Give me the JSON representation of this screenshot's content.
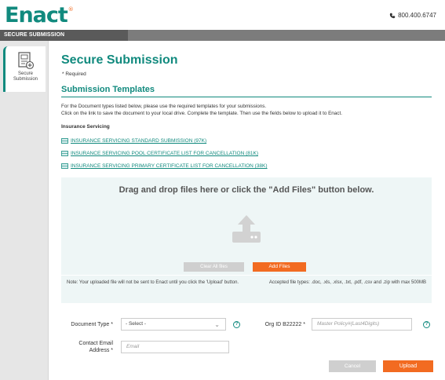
{
  "header": {
    "logo_text": "Enact",
    "logo_mark": "®",
    "phone": "800.400.6747",
    "phone_icon": "phone-icon"
  },
  "topbar": {
    "label": "SECURE SUBMISSION"
  },
  "sidebar": {
    "items": [
      {
        "label_line1": "Secure",
        "label_line2": "Submission",
        "icon": "document-add-icon"
      }
    ]
  },
  "main": {
    "title": "Secure Submission",
    "required_note": "* Required",
    "subtitle": "Submission Templates",
    "instructions_line1": "For the Document types listed below, please use the required templates for your submissions.",
    "instructions_line2": "Click on the link to save the document to your local drive. Complete the template. Then use the fields below to upload it to Enact.",
    "section_label": "Insurance Servicing",
    "documents": [
      {
        "label": "INSURANCE SERVICING STANDARD SUBMISSION (97K)",
        "icon": "spreadsheet-icon"
      },
      {
        "label": "INSURANCE SERVICING POOL CERTIFICATE LIST FOR CANCELLATION (81K)",
        "icon": "spreadsheet-icon"
      },
      {
        "label": "INSURANCE SERVICING PRIMARY CERTIFICATE LIST FOR CANCELLATION (38K)",
        "icon": "spreadsheet-icon"
      }
    ]
  },
  "dropzone": {
    "title": "Drag and drop files here or click the \"Add Files\" button below.",
    "icon": "upload-icon",
    "clear_label": "Clear All files",
    "add_label": "Add Files",
    "note": "Note: Your uploaded file will not be sent to Enact until you click the 'Upload' button.",
    "accepted": "Accepted file types: .doc, .xls, .xlsx, .txt, .pdf, .csv and .zip with max 500MB"
  },
  "form": {
    "doc_type_label": "Document Type *",
    "doc_type_value": "- Select -",
    "org_label": "Org ID B22222 *",
    "policy_placeholder": "Master Policy#(Last4Digits)",
    "email_label_line1": "Contact Email",
    "email_label_line2": "Address *",
    "email_placeholder": "Email",
    "help_glyph": "?"
  },
  "actions": {
    "cancel_label": "Cancel",
    "upload_label": "Upload"
  },
  "colors": {
    "brand_teal": "#118a7e",
    "accent_orange": "#f26b21"
  }
}
